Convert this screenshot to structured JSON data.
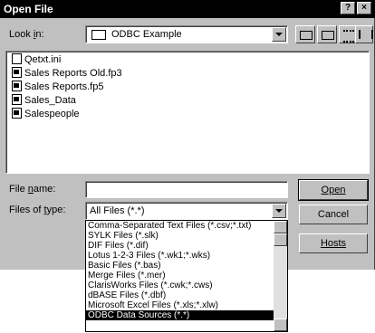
{
  "title": "Open File",
  "titlebar": {
    "help": "?",
    "close": "×"
  },
  "look_in": {
    "label": "Look in:",
    "value": "ODBC Example"
  },
  "files": [
    {
      "name": "Qetxt.ini",
      "icon": "text-file-icon"
    },
    {
      "name": "Sales Reports Old.fp3",
      "icon": "filemaker-file-icon"
    },
    {
      "name": "Sales Reports.fp5",
      "icon": "filemaker-file-icon"
    },
    {
      "name": "Sales_Data",
      "icon": "dsn-file-icon"
    },
    {
      "name": "Salespeople",
      "icon": "dsn-file-icon"
    }
  ],
  "file_name": {
    "label": "File name:",
    "value": ""
  },
  "file_type": {
    "label": "Files of type:",
    "value": "All Files (*.*)"
  },
  "buttons": {
    "open": "Open",
    "cancel": "Cancel",
    "hosts": "Hosts"
  },
  "type_options": [
    "Comma-Separated Text Files (*.csv;*.txt)",
    "SYLK Files (*.slk)",
    "DIF Files (*.dif)",
    "Lotus 1-2-3 Files (*.wk1;*.wks)",
    "Basic Files (*.bas)",
    "Merge Files (*.mer)",
    "ClarisWorks Files (*.cwk;*.cws)",
    "dBASE Files (*.dbf)",
    "Microsoft Excel Files (*.xls;*.xlw)",
    "ODBC Data Sources (*.*)"
  ]
}
